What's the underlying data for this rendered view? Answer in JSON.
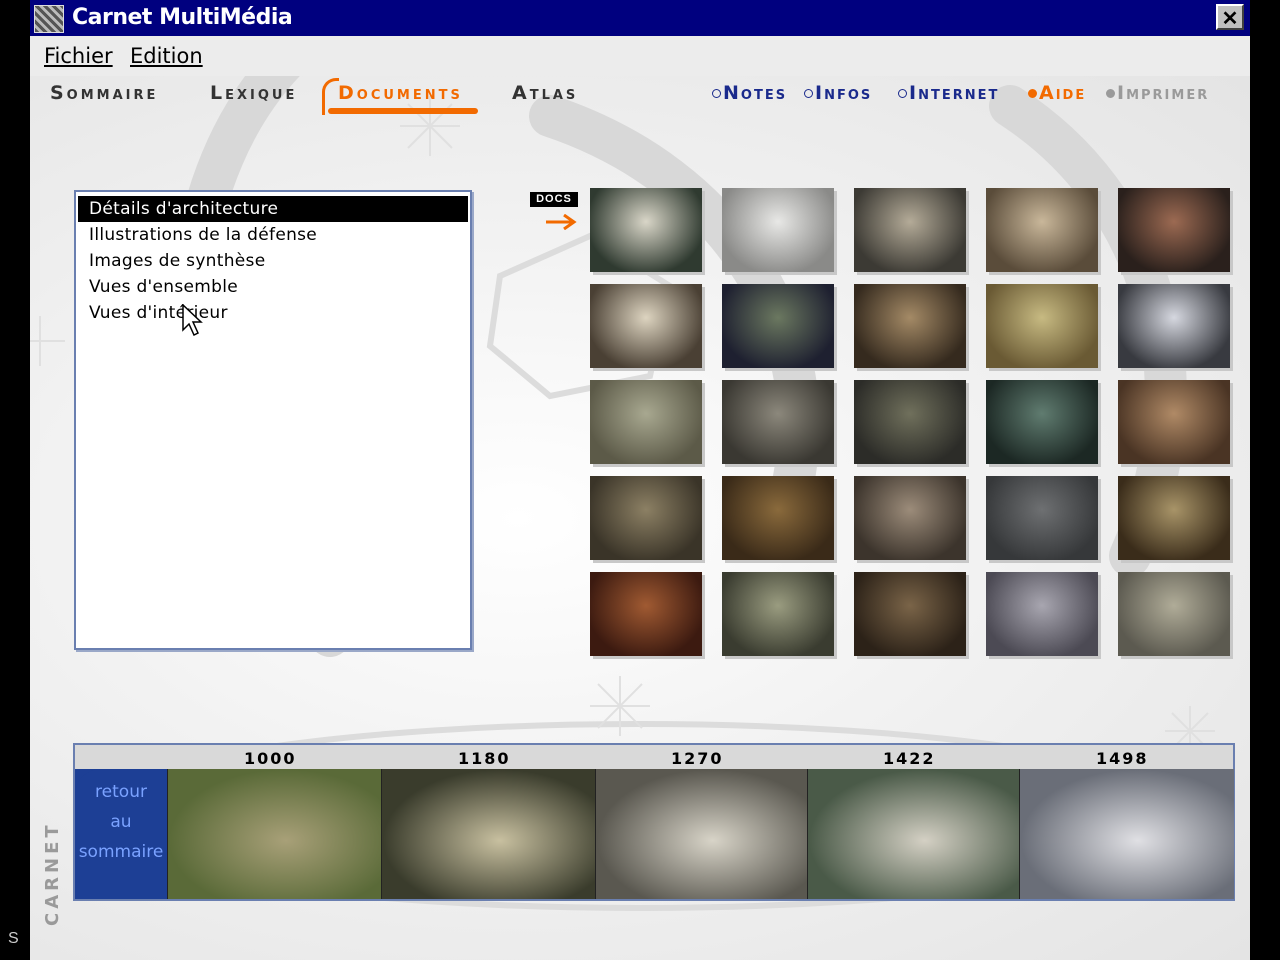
{
  "window": {
    "title": "Carnet MultiMédia",
    "close_glyph": "✕"
  },
  "menu": {
    "file": "Fichier",
    "edit": "Edition"
  },
  "nav": {
    "left": [
      {
        "id": "sommaire",
        "label": "Sommaire",
        "active": false
      },
      {
        "id": "lexique",
        "label": "Lexique",
        "active": false
      },
      {
        "id": "documents",
        "label": "Documents",
        "active": true
      },
      {
        "id": "atlas",
        "label": "Atlas",
        "active": false
      }
    ],
    "right": [
      {
        "id": "notes",
        "label": "Notes",
        "color": "#1a2a8c"
      },
      {
        "id": "infos",
        "label": "Infos",
        "color": "#1a2a8c"
      },
      {
        "id": "internet",
        "label": "Internet",
        "color": "#1a2a8c"
      },
      {
        "id": "aide",
        "label": "Aide",
        "color": "#f26a00"
      },
      {
        "id": "imprimer",
        "label": "Imprimer",
        "color": "#9a9a9a"
      }
    ],
    "accent": "#f26a00"
  },
  "categories": {
    "selected_index": 0,
    "items": [
      "Détails d'architecture",
      "Illustrations de la défense",
      "Images de synthèse",
      "Vues d'ensemble",
      "Vues d'intérieur"
    ]
  },
  "docs_badge": "DOCS",
  "thumbnails": [
    {
      "name": "spiral-staircase",
      "c1": "#2f3a30",
      "c2": "#d9d6c8"
    },
    {
      "name": "carved-keystone",
      "c1": "#8a8a88",
      "c2": "#e8e8e6"
    },
    {
      "name": "vaulted-hall",
      "c1": "#3c3a34",
      "c2": "#b4ab98"
    },
    {
      "name": "long-vaulted-corridor",
      "c1": "#5a4c3a",
      "c2": "#c9b79a"
    },
    {
      "name": "dark-chamber",
      "c1": "#2a201c",
      "c2": "#9c6a52"
    },
    {
      "name": "fireplace-room",
      "c1": "#4a4034",
      "c2": "#ddd4c0"
    },
    {
      "name": "stained-glass-vault",
      "c1": "#1e2030",
      "c2": "#6b7860"
    },
    {
      "name": "arched-passage",
      "c1": "#352a1e",
      "c2": "#a48a66"
    },
    {
      "name": "ribbed-arch",
      "c1": "#6a5a34",
      "c2": "#c7ba82"
    },
    {
      "name": "ruined-courtyard-snow",
      "c1": "#383a40",
      "c2": "#d6d8e0"
    },
    {
      "name": "tower-ruin",
      "c1": "#5c5a48",
      "c2": "#a8a890"
    },
    {
      "name": "carved-pillar",
      "c1": "#3a3832",
      "c2": "#8c887c"
    },
    {
      "name": "stone-wall-niche",
      "c1": "#2c2c28",
      "c2": "#70705c"
    },
    {
      "name": "green-vault",
      "c1": "#1c2824",
      "c2": "#607c70"
    },
    {
      "name": "arched-doorways",
      "c1": "#4a3424",
      "c2": "#b08a66"
    },
    {
      "name": "star-vault",
      "c1": "#3a3428",
      "c2": "#8c8064"
    },
    {
      "name": "pointed-vault",
      "c1": "#3a2a18",
      "c2": "#8a6a3c"
    },
    {
      "name": "stone-alcove",
      "c1": "#3c342c",
      "c2": "#9c8c7a"
    },
    {
      "name": "grey-wall",
      "c1": "#36383a",
      "c2": "#6e7072"
    },
    {
      "name": "timber-roof-room",
      "c1": "#3a2c1a",
      "c2": "#a89468"
    },
    {
      "name": "gothic-chapel",
      "c1": "#3c1a10",
      "c2": "#a05a32"
    },
    {
      "name": "fan-vault",
      "c1": "#3a3c30",
      "c2": "#9a9c80"
    },
    {
      "name": "wooden-furniture-room",
      "c1": "#2c2218",
      "c2": "#7a6448"
    },
    {
      "name": "vaulted-crypt",
      "c1": "#4c4a54",
      "c2": "#a8a6b0"
    },
    {
      "name": "castle-courtyard",
      "c1": "#5c5a50",
      "c2": "#b0ac98"
    }
  ],
  "timeline": {
    "return_label": [
      "retour",
      "au",
      "sommaire"
    ],
    "vertical_brand": "CARNET",
    "years": [
      {
        "year": "1000",
        "c1": "#5a6a38",
        "c2": "#a8a078"
      },
      {
        "year": "1180",
        "c1": "#3a3c2c",
        "c2": "#c8c0a0"
      },
      {
        "year": "1270",
        "c1": "#5a5850",
        "c2": "#d8d4c8"
      },
      {
        "year": "1422",
        "c1": "#4a5a48",
        "c2": "#d4d0c4"
      },
      {
        "year": "1498",
        "c1": "#6a6e78",
        "c2": "#e0e0e4"
      }
    ]
  },
  "edge_text": "S"
}
